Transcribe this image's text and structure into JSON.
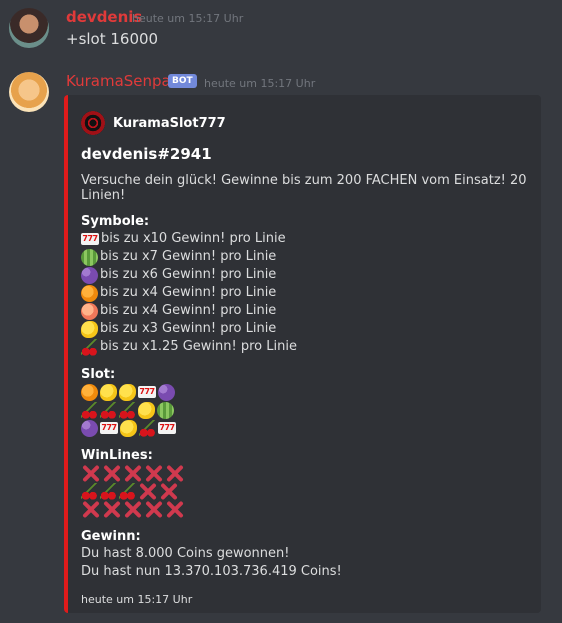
{
  "messages": [
    {
      "username": "devdenis",
      "timestamp": "heute um 15:17 Uhr",
      "content": "+slot 16000"
    },
    {
      "username": "KuramaSenpai",
      "badge": "BOT",
      "timestamp": "heute um 15:17 Uhr"
    }
  ],
  "embed": {
    "accent_color": "#e01b1b",
    "author": "KuramaSlot777",
    "title": "devdenis#2941",
    "description": "Versuche dein glück! Gewinne bis zum 200 FACHEN vom Einsatz! 20 Linien!",
    "symbols_label": "Symbole:",
    "symbols": [
      {
        "icon": "seven-icon",
        "text": "bis zu x10 Gewinn! pro Linie"
      },
      {
        "icon": "melon-icon",
        "text": "bis zu x7 Gewinn! pro Linie"
      },
      {
        "icon": "grapes-icon",
        "text": "bis zu x6 Gewinn! pro Linie"
      },
      {
        "icon": "tangerine-icon",
        "text": "bis zu x4 Gewinn! pro Linie"
      },
      {
        "icon": "peach-icon",
        "text": "bis zu x4 Gewinn! pro Linie"
      },
      {
        "icon": "lemon-icon",
        "text": "bis zu x3 Gewinn! pro Linie"
      },
      {
        "icon": "cherries-icon",
        "text": "bis zu x1.25 Gewinn! pro Linie"
      }
    ],
    "slot_label": "Slot:",
    "slot_grid": [
      [
        "tangerine",
        "lemon",
        "lemon",
        "seven",
        "grapes"
      ],
      [
        "cherries",
        "cherries",
        "cherries",
        "lemon",
        "melon"
      ],
      [
        "grapes",
        "seven",
        "lemon",
        "cherries",
        "seven"
      ]
    ],
    "winlines_label": "WinLines:",
    "winlines_grid": [
      [
        "x",
        "x",
        "x",
        "x",
        "x"
      ],
      [
        "cherries",
        "cherries",
        "cherries",
        "x",
        "x"
      ],
      [
        "x",
        "x",
        "x",
        "x",
        "x"
      ]
    ],
    "gewinn_label": "Gewinn:",
    "gewinn_line1": "Du hast 8.000 Coins gewonnen!",
    "gewinn_line2": "Du hast nun 13.370.103.736.419 Coins!",
    "footer": "heute um 15:17 Uhr"
  }
}
